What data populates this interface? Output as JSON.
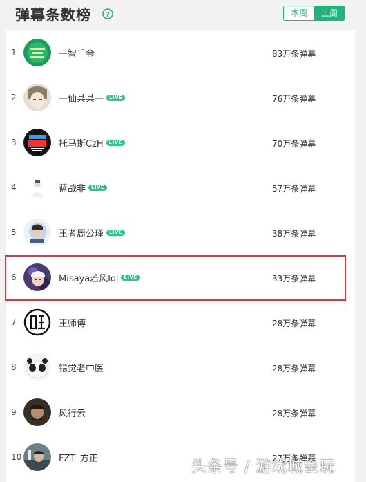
{
  "header": {
    "title": "弹幕条数榜",
    "toggle": {
      "this_week": "本周",
      "last_week": "上周"
    }
  },
  "ranking": [
    {
      "rank": "1",
      "name": "一智千金",
      "live": "",
      "count": "83万条弹幕"
    },
    {
      "rank": "2",
      "name": "一仙某某一",
      "live": "LIVE",
      "count": "76万条弹幕"
    },
    {
      "rank": "3",
      "name": "托马斯CzH",
      "live": "LIVE",
      "count": "70万条弹幕"
    },
    {
      "rank": "4",
      "name": "蓝战非",
      "live": "LIVE",
      "count": "57万条弹幕"
    },
    {
      "rank": "5",
      "name": "王者周公瑾",
      "live": "LIVE",
      "count": "38万条弹幕"
    },
    {
      "rank": "6",
      "name": "Misaya若风lol",
      "live": "LIVE",
      "count": "33万条弹幕"
    },
    {
      "rank": "7",
      "name": "王师傅",
      "live": "",
      "count": "28万条弹幕"
    },
    {
      "rank": "8",
      "name": "错觉老中医",
      "live": "",
      "count": "28万条弹幕"
    },
    {
      "rank": "9",
      "name": "风行云",
      "live": "",
      "count": "28万条弹幕"
    },
    {
      "rank": "10",
      "name": "FZT_方正",
      "live": "",
      "count": "27万条弹幕"
    }
  ],
  "watermark": "头条号 / 游戏城会玩",
  "colors": {
    "accent": "#21b37b",
    "live_badge": "#2fc28a",
    "highlight_border": "#e0343c"
  }
}
